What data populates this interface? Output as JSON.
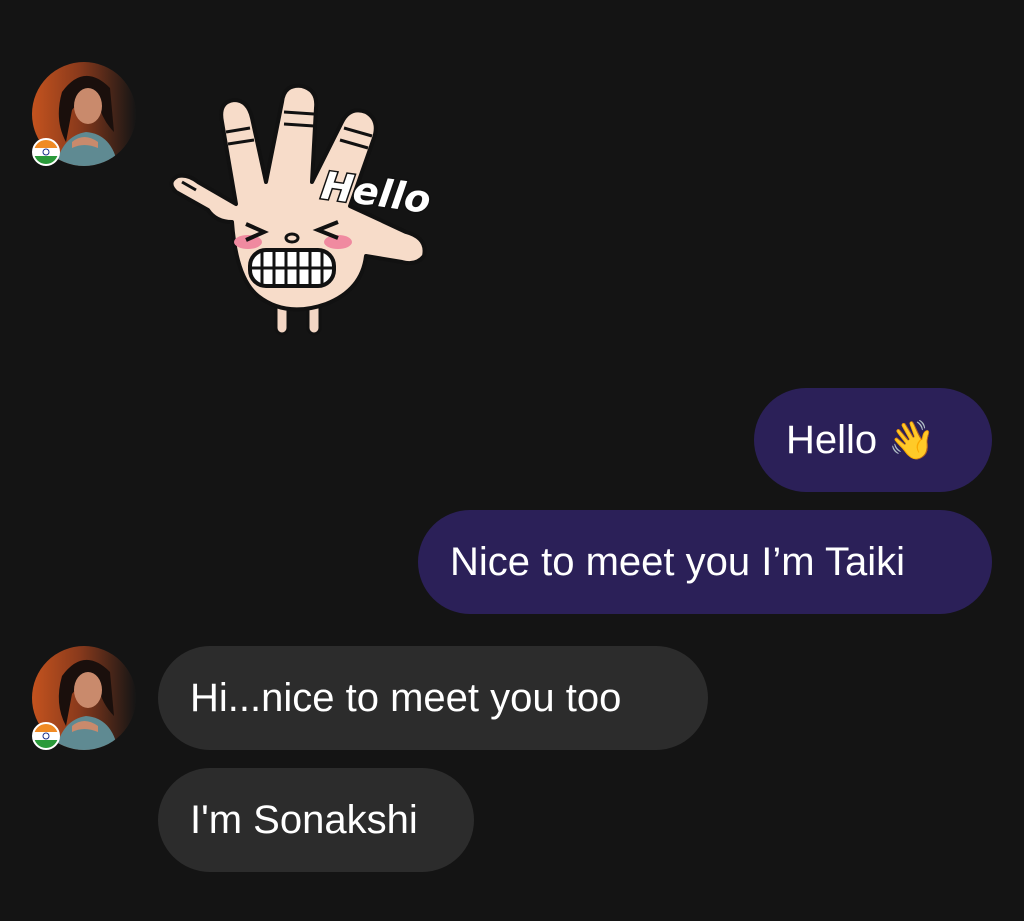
{
  "messages": [
    {
      "id": "sticker",
      "side": "in",
      "kind": "sticker",
      "sticker_text": "Hello"
    },
    {
      "id": "m1",
      "side": "out",
      "text": "Hello",
      "emoji": "👋"
    },
    {
      "id": "m2",
      "side": "out",
      "text": "Nice to meet you I’m Taiki"
    },
    {
      "id": "m3",
      "side": "in",
      "text": "Hi...nice to meet you too"
    },
    {
      "id": "m4",
      "side": "in",
      "text": "I'm Sonakshi"
    }
  ],
  "contact": {
    "country_flag_icon": "india-flag-icon",
    "avatar_icon": "contact-avatar-photo"
  },
  "colors": {
    "background": "#141414",
    "outgoing_bubble": "#2b2058",
    "incoming_bubble": "#2c2c2c",
    "text": "#ffffff"
  }
}
